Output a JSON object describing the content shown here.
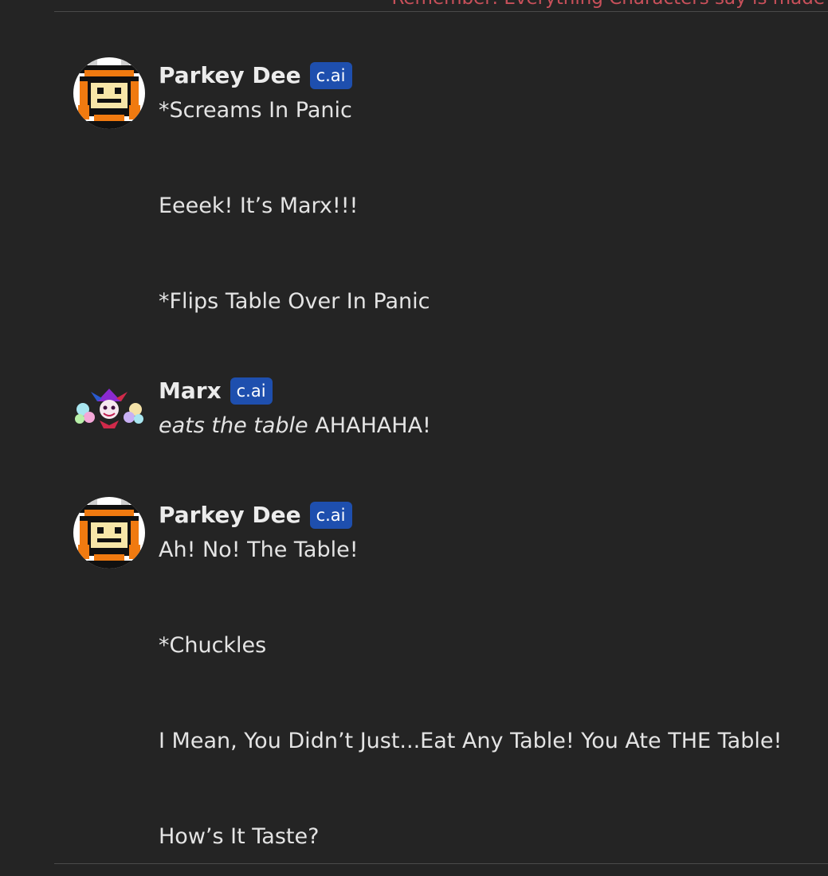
{
  "disclaimer": "Remember: Everything Characters say is made",
  "badge_label": "c.ai",
  "messages": [
    {
      "author": "Parkey Dee",
      "avatar_icon": "pixel-face-avatar-icon",
      "lines": [
        "*Screams In Panic",
        "Eeeek! It’s Marx!!!",
        "*Flips Table Over In Panic"
      ]
    },
    {
      "author": "Marx",
      "avatar_icon": "marx-jester-avatar-icon",
      "italic": "eats the table",
      "rest": " AHAHAHA!"
    },
    {
      "author": "Parkey Dee",
      "avatar_icon": "pixel-face-avatar-icon",
      "lines": [
        "Ah! No! The Table!",
        "*Chuckles",
        "I Mean, You Didn’t Just...Eat Any Table! You Ate THE Table!",
        "How’s It Taste?"
      ]
    }
  ],
  "colors": {
    "background": "#242424",
    "badge": "#1e4fae",
    "disclaimer": "#c8505a",
    "avatar_orange": "#f07a10",
    "avatar_face": "#f7e6a8"
  }
}
